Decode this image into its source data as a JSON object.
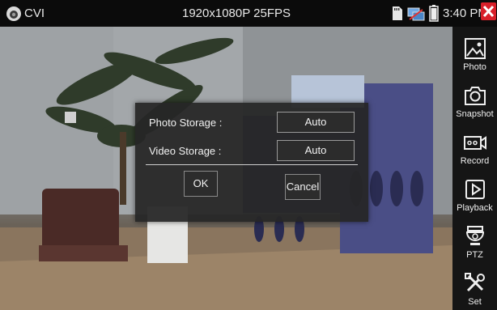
{
  "status_bar": {
    "app_title": "CVI",
    "resolution": "1920x1080P 25FPS",
    "time": "3:40 PM",
    "icons": [
      "camera-icon",
      "sd-card-icon",
      "network-icon",
      "battery-icon",
      "close-icon"
    ],
    "close_color": "#d8202a"
  },
  "sidebar": {
    "items": [
      {
        "label": "Photo",
        "icon": "photo-icon"
      },
      {
        "label": "Snapshot",
        "icon": "camera-icon"
      },
      {
        "label": "Record",
        "icon": "record-icon"
      },
      {
        "label": "Playback",
        "icon": "playback-icon"
      },
      {
        "label": "PTZ",
        "icon": "ptz-camera-icon"
      },
      {
        "label": "Set",
        "icon": "tools-icon"
      }
    ]
  },
  "dialog": {
    "photo_storage_label": "Photo Storage :",
    "photo_storage_value": "Auto",
    "video_storage_label": "Video Storage :",
    "video_storage_value": "Auto",
    "ok_label": "OK",
    "cancel_label": "Cancel"
  }
}
